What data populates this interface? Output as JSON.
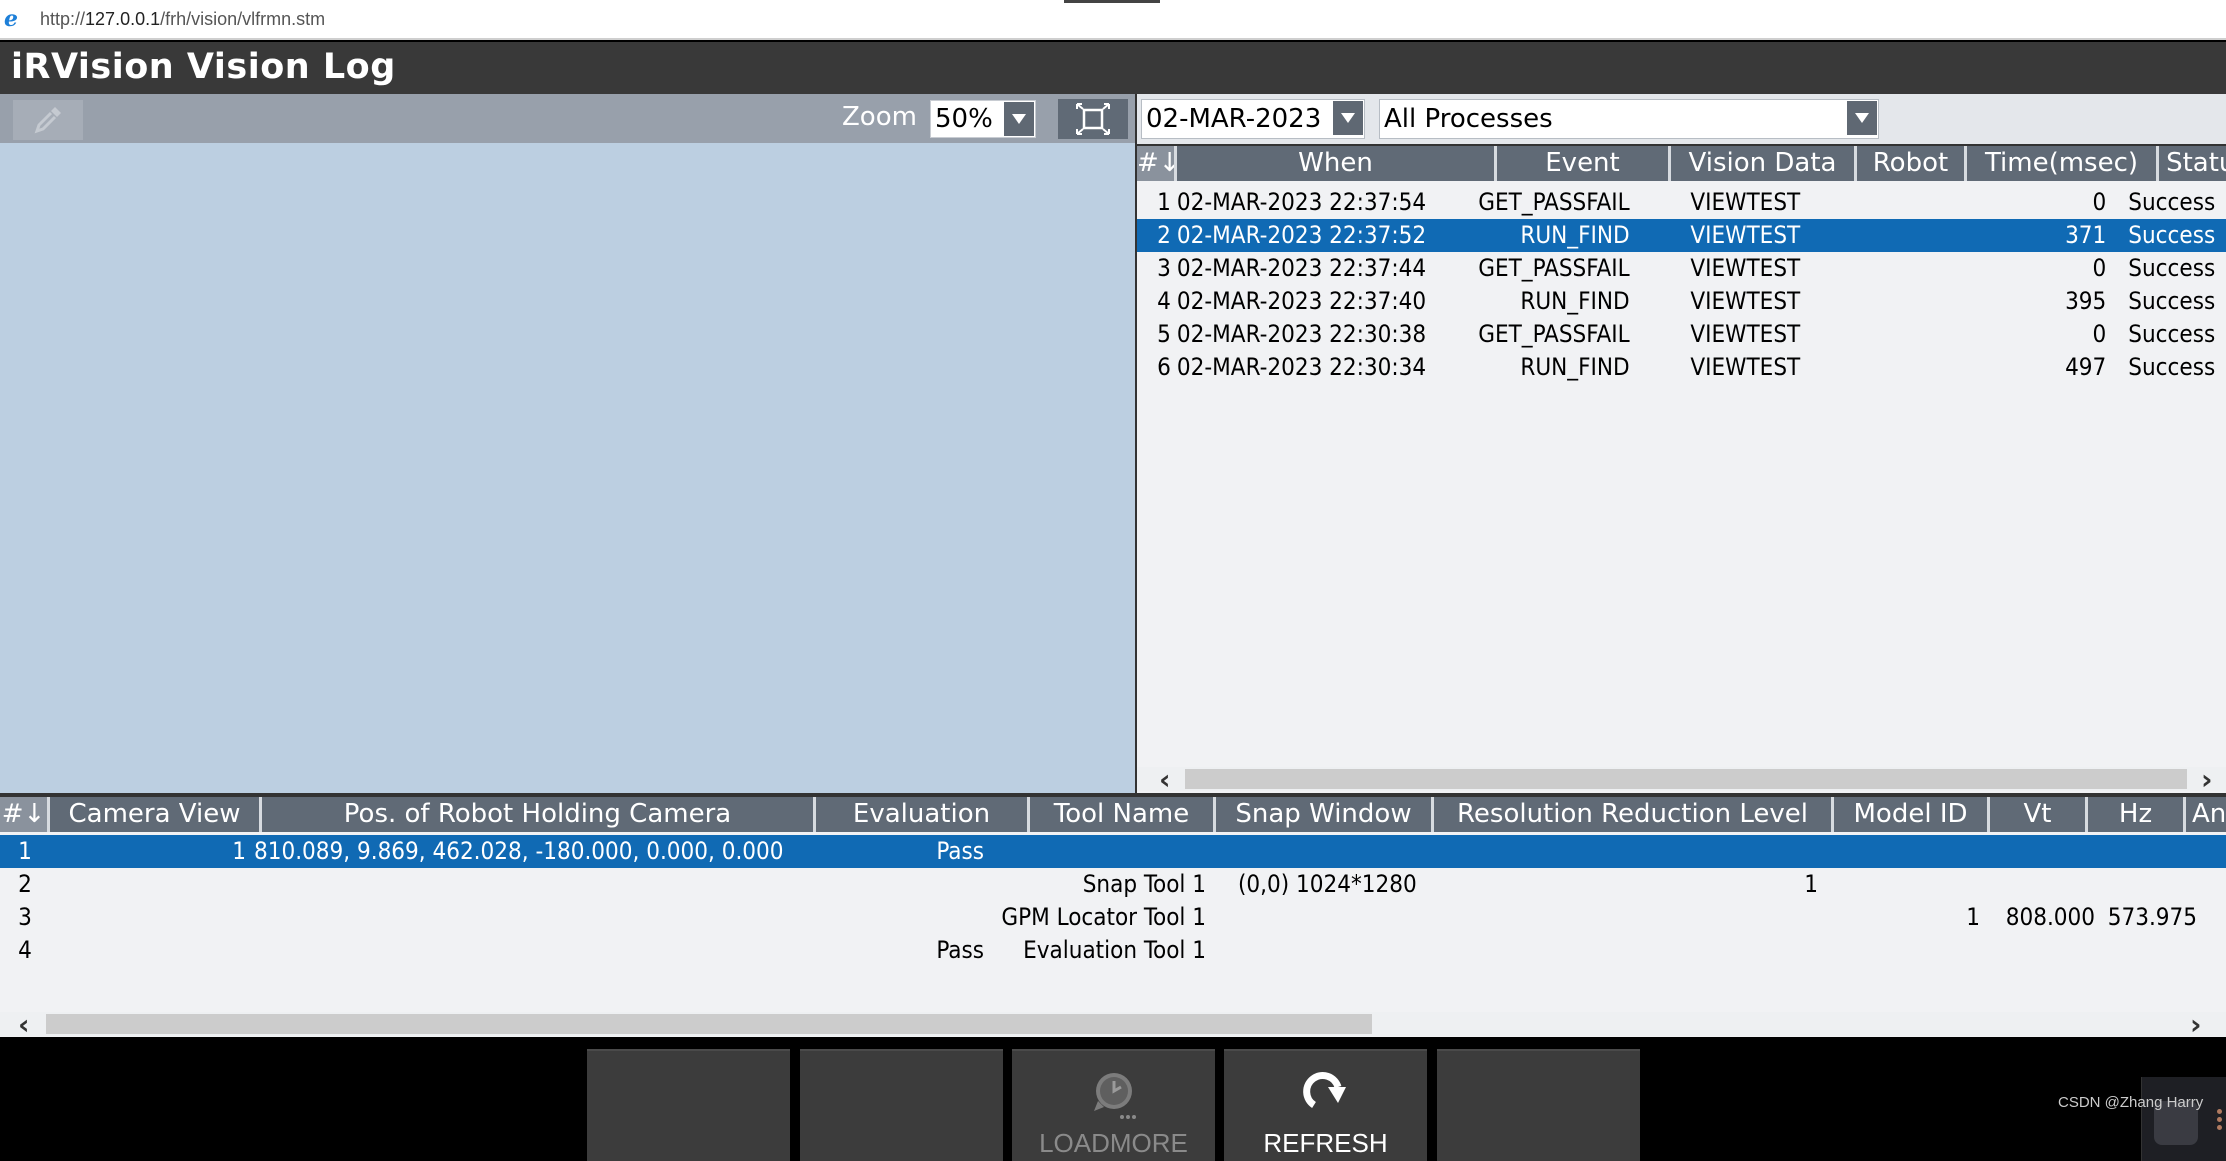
{
  "browser": {
    "url_prefix": "http://",
    "url_host": "127.0.0.1",
    "url_path": "/frh/vision/vlfrmn.stm"
  },
  "header": {
    "title": "iRVision Vision Log"
  },
  "toolbar": {
    "zoom_label": "Zoom",
    "zoom_value": "50%",
    "date_value": "02-MAR-2023",
    "process_value": "All Processes"
  },
  "log_table": {
    "columns": [
      "#↓",
      "When",
      "Event",
      "Vision Data",
      "Robot",
      "Time(msec)",
      "Status"
    ],
    "rows": [
      {
        "num": "1",
        "when": "02-MAR-2023 22:37:54",
        "event": "GET_PASSFAIL",
        "vision_data": "VIEWTEST",
        "robot": "",
        "time": "0",
        "status": "Success"
      },
      {
        "num": "2",
        "when": "02-MAR-2023 22:37:52",
        "event": "RUN_FIND",
        "vision_data": "VIEWTEST",
        "robot": "",
        "time": "371",
        "status": "Success"
      },
      {
        "num": "3",
        "when": "02-MAR-2023 22:37:44",
        "event": "GET_PASSFAIL",
        "vision_data": "VIEWTEST",
        "robot": "",
        "time": "0",
        "status": "Success"
      },
      {
        "num": "4",
        "when": "02-MAR-2023 22:37:40",
        "event": "RUN_FIND",
        "vision_data": "VIEWTEST",
        "robot": "",
        "time": "395",
        "status": "Success"
      },
      {
        "num": "5",
        "when": "02-MAR-2023 22:30:38",
        "event": "GET_PASSFAIL",
        "vision_data": "VIEWTEST",
        "robot": "",
        "time": "0",
        "status": "Success"
      },
      {
        "num": "6",
        "when": "02-MAR-2023 22:30:34",
        "event": "RUN_FIND",
        "vision_data": "VIEWTEST",
        "robot": "",
        "time": "497",
        "status": "Success"
      }
    ],
    "selected_row": 2
  },
  "detail_table": {
    "columns": [
      "#↓",
      "Camera View",
      "Pos. of Robot Holding Camera",
      "Evaluation",
      "Tool Name",
      "Snap Window",
      "Resolution Reduction Level",
      "Model ID",
      "Vt",
      "Hz",
      "An"
    ],
    "rows": [
      {
        "num": "1",
        "camera_view": "1",
        "pos": "810.089, 9.869, 462.028, -180.000, 0.000, 0.000",
        "evaluation": "Pass",
        "tool_name": "",
        "snap_window": "",
        "res_level": "",
        "model_id": "",
        "vt": "",
        "hz": ""
      },
      {
        "num": "2",
        "camera_view": "",
        "pos": "",
        "evaluation": "",
        "tool_name": "Snap Tool 1",
        "snap_window": "(0,0) 1024*1280",
        "res_level": "1",
        "model_id": "",
        "vt": "",
        "hz": ""
      },
      {
        "num": "3",
        "camera_view": "",
        "pos": "",
        "evaluation": "",
        "tool_name": "GPM Locator Tool 1",
        "snap_window": "",
        "res_level": "",
        "model_id": "1",
        "vt": "808.000",
        "hz": "573.975"
      },
      {
        "num": "4",
        "camera_view": "",
        "pos": "",
        "evaluation": "Pass",
        "tool_name": "Evaluation Tool 1",
        "snap_window": "",
        "res_level": "",
        "model_id": "",
        "vt": "",
        "hz": ""
      }
    ],
    "selected_row": 1
  },
  "footer": {
    "buttons": [
      {
        "label": ""
      },
      {
        "label": ""
      },
      {
        "label": "LOADMORE",
        "icon": "clock-history-icon",
        "enabled": false
      },
      {
        "label": "REFRESH",
        "icon": "refresh-icon",
        "enabled": true
      },
      {
        "label": ""
      }
    ]
  },
  "watermark": "CSDN @Zhang Harry",
  "colors": {
    "selection": "#106ab4",
    "header_bg": "#606a76",
    "title_bg": "#393939",
    "image_panel_bg": "#bccfe1"
  }
}
